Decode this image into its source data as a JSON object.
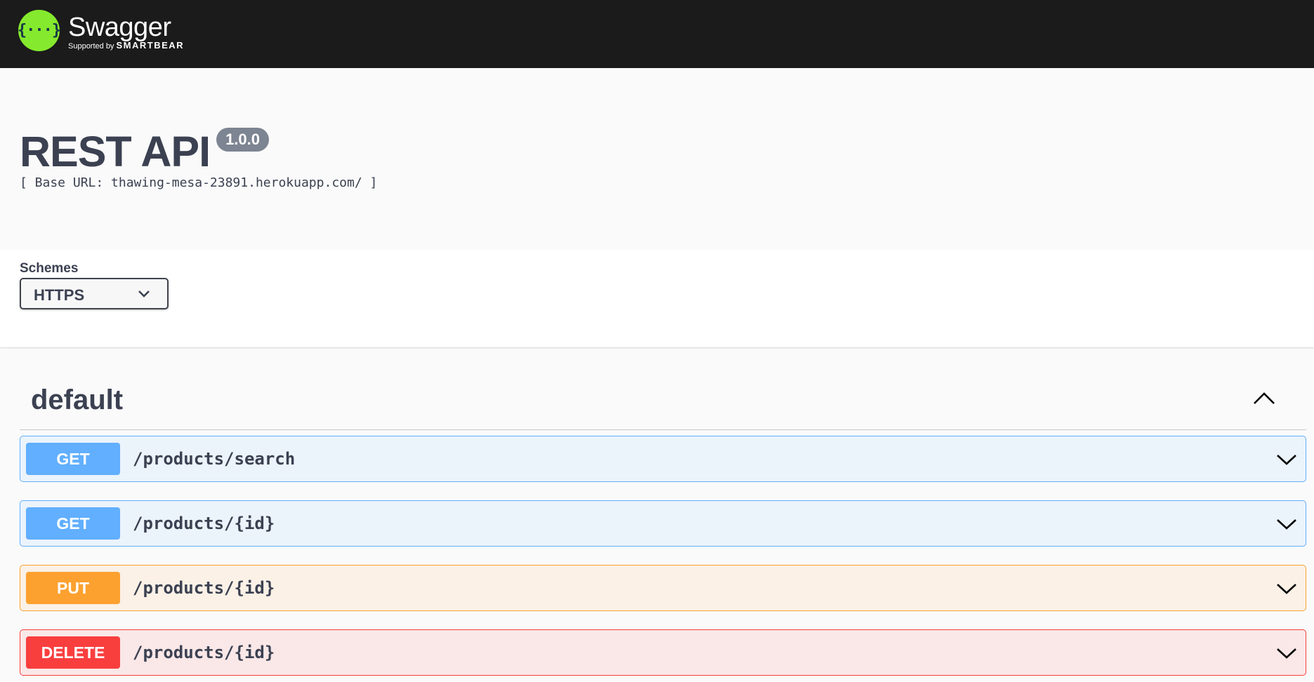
{
  "topbar": {
    "logo_glyph": "{···}",
    "brand": "Swagger",
    "supported_by": "Supported by",
    "company": "SMARTBEAR",
    "accent_color": "#85ea2d"
  },
  "info": {
    "title": "REST API",
    "version": "1.0.0",
    "base_url": "[ Base URL: thawing-mesa-23891.herokuapp.com/ ]"
  },
  "schemes": {
    "label": "Schemes",
    "selected": "HTTPS"
  },
  "section": {
    "title": "default",
    "toggle_icon": "chevron-up-icon"
  },
  "operations": [
    {
      "method": "GET",
      "path": "/products/search",
      "color": "#61affe"
    },
    {
      "method": "GET",
      "path": "/products/{id}",
      "color": "#61affe"
    },
    {
      "method": "PUT",
      "path": "/products/{id}",
      "color": "#fca130"
    },
    {
      "method": "DELETE",
      "path": "/products/{id}",
      "color": "#f93e3e"
    }
  ]
}
